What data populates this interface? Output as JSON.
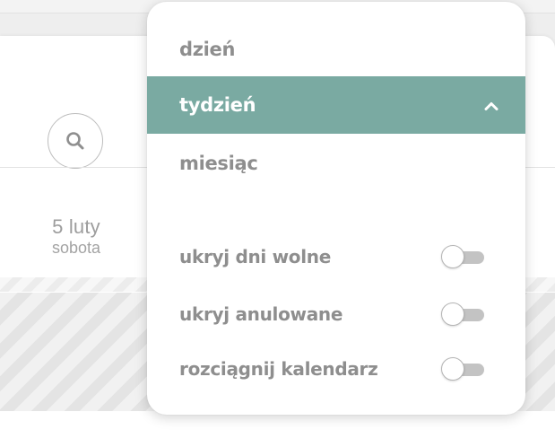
{
  "calendar": {
    "day": {
      "date": "5 luty",
      "weekday": "sobota"
    }
  },
  "icons": {
    "search": "search-icon",
    "chevron": "chevron-up-icon"
  },
  "colors": {
    "selected_background": "#7aaaa2",
    "menu_text": "#8e8e8e",
    "toggle_off_track": "#c3c3c3"
  },
  "view_menu": {
    "items": [
      {
        "label": "dzień",
        "selected": false
      },
      {
        "label": "tydzień",
        "selected": true
      },
      {
        "label": "miesiąc",
        "selected": false
      }
    ]
  },
  "options": [
    {
      "label": "ukryj dni wolne",
      "enabled": false
    },
    {
      "label": "ukryj anulowane",
      "enabled": false
    },
    {
      "label": "rozciągnij kalendarz",
      "enabled": false
    }
  ]
}
